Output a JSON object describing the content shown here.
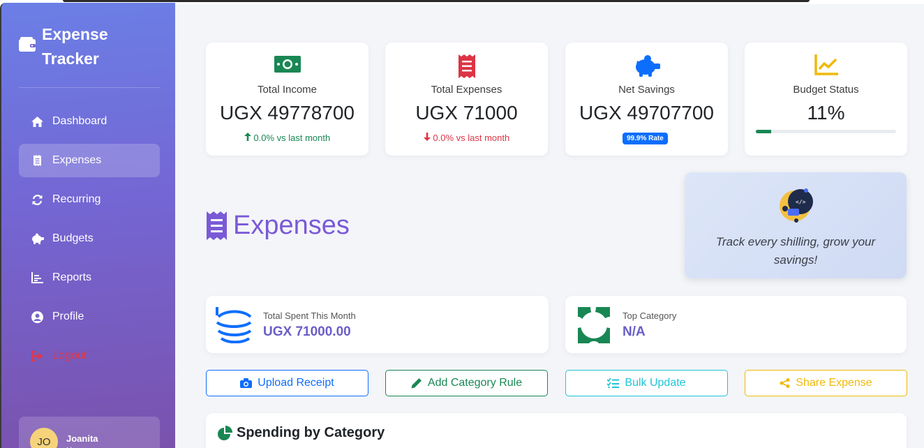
{
  "sidebar": {
    "brand_line1": "Expense",
    "brand_line2": "Tracker",
    "items": [
      {
        "label": "Dashboard",
        "icon": "home-icon"
      },
      {
        "label": "Expenses",
        "icon": "receipt-icon",
        "active": true
      },
      {
        "label": "Recurring",
        "icon": "sync-icon"
      },
      {
        "label": "Budgets",
        "icon": "piggy-bank-icon"
      },
      {
        "label": "Reports",
        "icon": "chart-icon"
      },
      {
        "label": "Profile",
        "icon": "user-circle-icon"
      },
      {
        "label": "Logout",
        "icon": "logout-icon"
      }
    ],
    "user": {
      "initials": "JO",
      "name": "Joanita",
      "role": "User"
    }
  },
  "stats": [
    {
      "label": "Total Income",
      "value": "UGX 49778700",
      "delta": "0.0% vs last month",
      "icon": "money-bill-icon"
    },
    {
      "label": "Total Expenses",
      "value": "UGX 71000",
      "delta": "0.0% vs last month",
      "icon": "receipt-icon"
    },
    {
      "label": "Net Savings",
      "value": "UGX 49707700",
      "badge": "99.9% Rate",
      "icon": "piggy-bank-icon"
    },
    {
      "label": "Budget Status",
      "value": "11%",
      "progress": 0.11,
      "icon": "chart-line-icon"
    }
  ],
  "page": {
    "title": "Expenses"
  },
  "motivation": {
    "text": "Track every shilling, grow your savings!"
  },
  "summary": [
    {
      "label": "Total Spent This Month",
      "value": "UGX 71000.00"
    },
    {
      "label": "Top Category",
      "value": "N/A"
    }
  ],
  "actions": {
    "upload": "Upload Receipt",
    "add_rule": "Add Category Rule",
    "bulk": "Bulk Update",
    "share": "Share Expense"
  },
  "spending": {
    "title": "Spending by Category"
  },
  "colors": {
    "accent_purple": "#7a5ad6",
    "income_green": "#198754",
    "expense_red": "#dc3545",
    "primary_blue": "#0d6efd",
    "info_cyan": "#20c5d8",
    "warning_yellow": "#f0b90b"
  }
}
